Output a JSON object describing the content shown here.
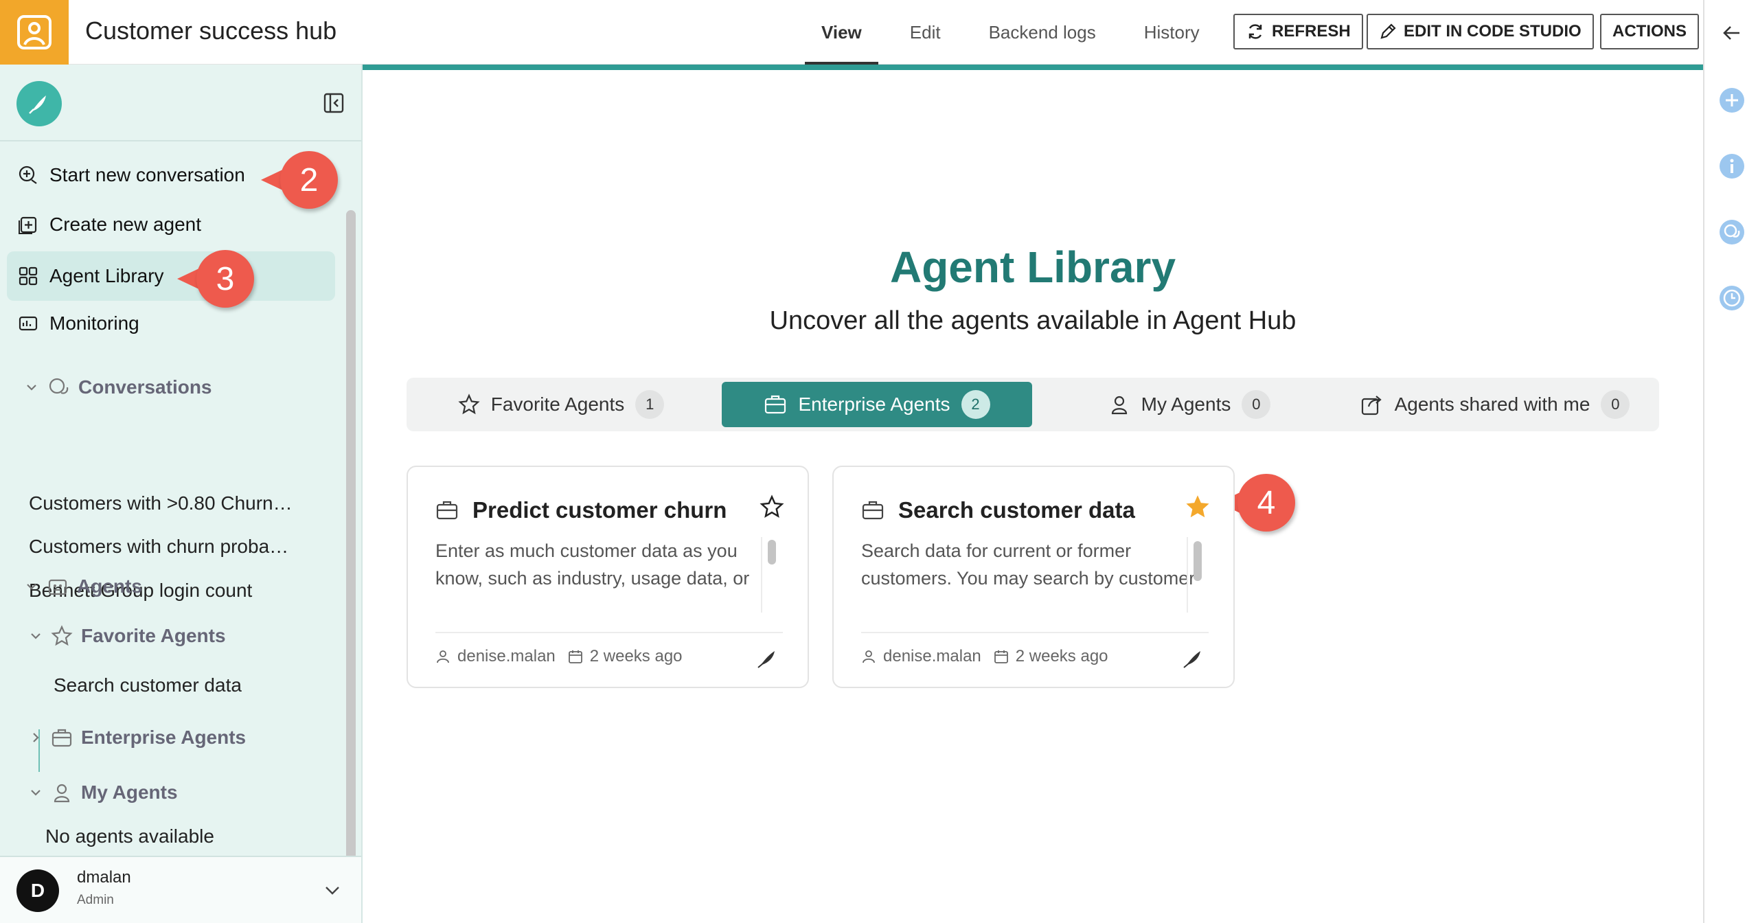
{
  "app": {
    "title": "Customer success hub",
    "brand_color": "#f2a72a",
    "accent_color": "#2f8b84"
  },
  "topnav": {
    "tabs": [
      {
        "label": "View",
        "active": true
      },
      {
        "label": "Edit",
        "active": false
      },
      {
        "label": "Backend logs",
        "active": false
      },
      {
        "label": "History",
        "active": false
      }
    ],
    "refresh_label": "REFRESH",
    "code_studio_label": "EDIT IN CODE STUDIO",
    "actions_label": "ACTIONS"
  },
  "rightrail": {
    "icons": [
      "back-arrow-icon",
      "plus-icon",
      "info-icon",
      "chat-icon",
      "clock-icon"
    ]
  },
  "sidebar": {
    "actions": [
      {
        "label": "Start new conversation",
        "icon": "new-chat-icon"
      },
      {
        "label": "Create new agent",
        "icon": "add-square-icon"
      },
      {
        "label": "Agent Library",
        "icon": "grid-icon",
        "active": true
      },
      {
        "label": "Monitoring",
        "icon": "monitor-icon"
      }
    ],
    "conversations": {
      "title": "Conversations",
      "items": [
        "Customers with >0.80 Churn…",
        "Customers with churn proba…",
        "Bennett Group login count"
      ]
    },
    "agents": {
      "title": "Agents",
      "favorite_title": "Favorite Agents",
      "favorite_items": [
        "Search customer data"
      ],
      "enterprise_title": "Enterprise Agents",
      "my_title": "My Agents",
      "my_empty": "No agents available"
    },
    "user": {
      "initial": "D",
      "name": "dmalan",
      "role": "Admin"
    }
  },
  "callouts": [
    "2",
    "3",
    "4"
  ],
  "main": {
    "title": "Agent Library",
    "subtitle": "Uncover all the agents available in Agent Hub",
    "filters": [
      {
        "label": "Favorite Agents",
        "count": "1",
        "icon": "star-icon"
      },
      {
        "label": "Enterprise Agents",
        "count": "2",
        "icon": "briefcase-icon",
        "active": true
      },
      {
        "label": "My Agents",
        "count": "0",
        "icon": "user-icon"
      },
      {
        "label": "Agents shared with me",
        "count": "0",
        "icon": "share-icon"
      }
    ],
    "cards": [
      {
        "title": "Predict customer churn",
        "description": "Enter as much customer data as you know, such as industry, usage data, or average satisfaction score. The",
        "author": "denise.malan",
        "date": "2 weeks ago",
        "favorite": false
      },
      {
        "title": "Search customer data",
        "description": "Search data for current or former customers. You may search by customer name, industry, usage data,",
        "author": "denise.malan",
        "date": "2 weeks ago",
        "favorite": true
      }
    ]
  }
}
